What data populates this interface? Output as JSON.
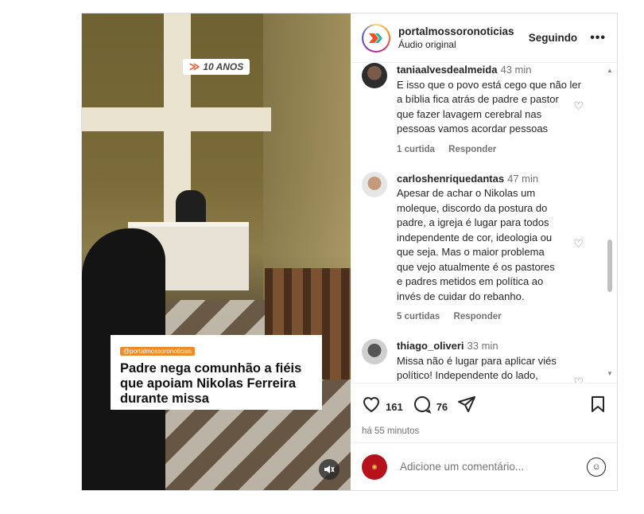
{
  "media": {
    "badge_mark": "≫",
    "badge_text": "10 ANOS",
    "caption_handle": "@portalmossoronoticias",
    "caption_headline": "Padre nega comunhão a fiéis que apoiam Nikolas Ferreira durante missa",
    "mute_icon": "speaker-muted"
  },
  "header": {
    "username": "portalmossoronoticias",
    "subtitle": "Áudio original",
    "follow_label": "Seguindo",
    "more_label": "•••"
  },
  "comments": [
    {
      "user": "taniaalvesdealmeida",
      "time": "43 min",
      "lines": [
        "E isso que o povo está cego que não ler",
        "a bíblia fica atrás de padre e pastor",
        "que fazer lavagem cerebral nas",
        "pessoas vamos acordar pessoas"
      ],
      "likes": "1 curtida",
      "reply": "Responder"
    },
    {
      "user": "carloshenriquedantas",
      "time": "47 min",
      "lines": [
        "Apesar de achar o Nikolas um",
        "moleque, discordo da postura do",
        "padre, a igreja é lugar para todos",
        "independente de cor, ideologia ou",
        "que seja. Mas o maior problema",
        "que vejo atualmente é os pastores",
        "e padres metidos em política ao",
        "invés de cuidar do rebanho."
      ],
      "likes": "5 curtidas",
      "reply": "Responder"
    },
    {
      "user": "thiago_oliveri",
      "time": "33 min",
      "lines": [
        "Missa não é lugar para aplicar viés",
        "político! Independente do lado,"
      ],
      "likes": "",
      "reply": ""
    }
  ],
  "actions": {
    "likes": "161",
    "comments": "76",
    "ago": "há 55 minutos"
  },
  "add_comment": {
    "placeholder": "Adicione um comentário..."
  },
  "colors": {
    "accent": "#f04e23",
    "muted_text": "#737373",
    "border": "#dbdbdb"
  }
}
